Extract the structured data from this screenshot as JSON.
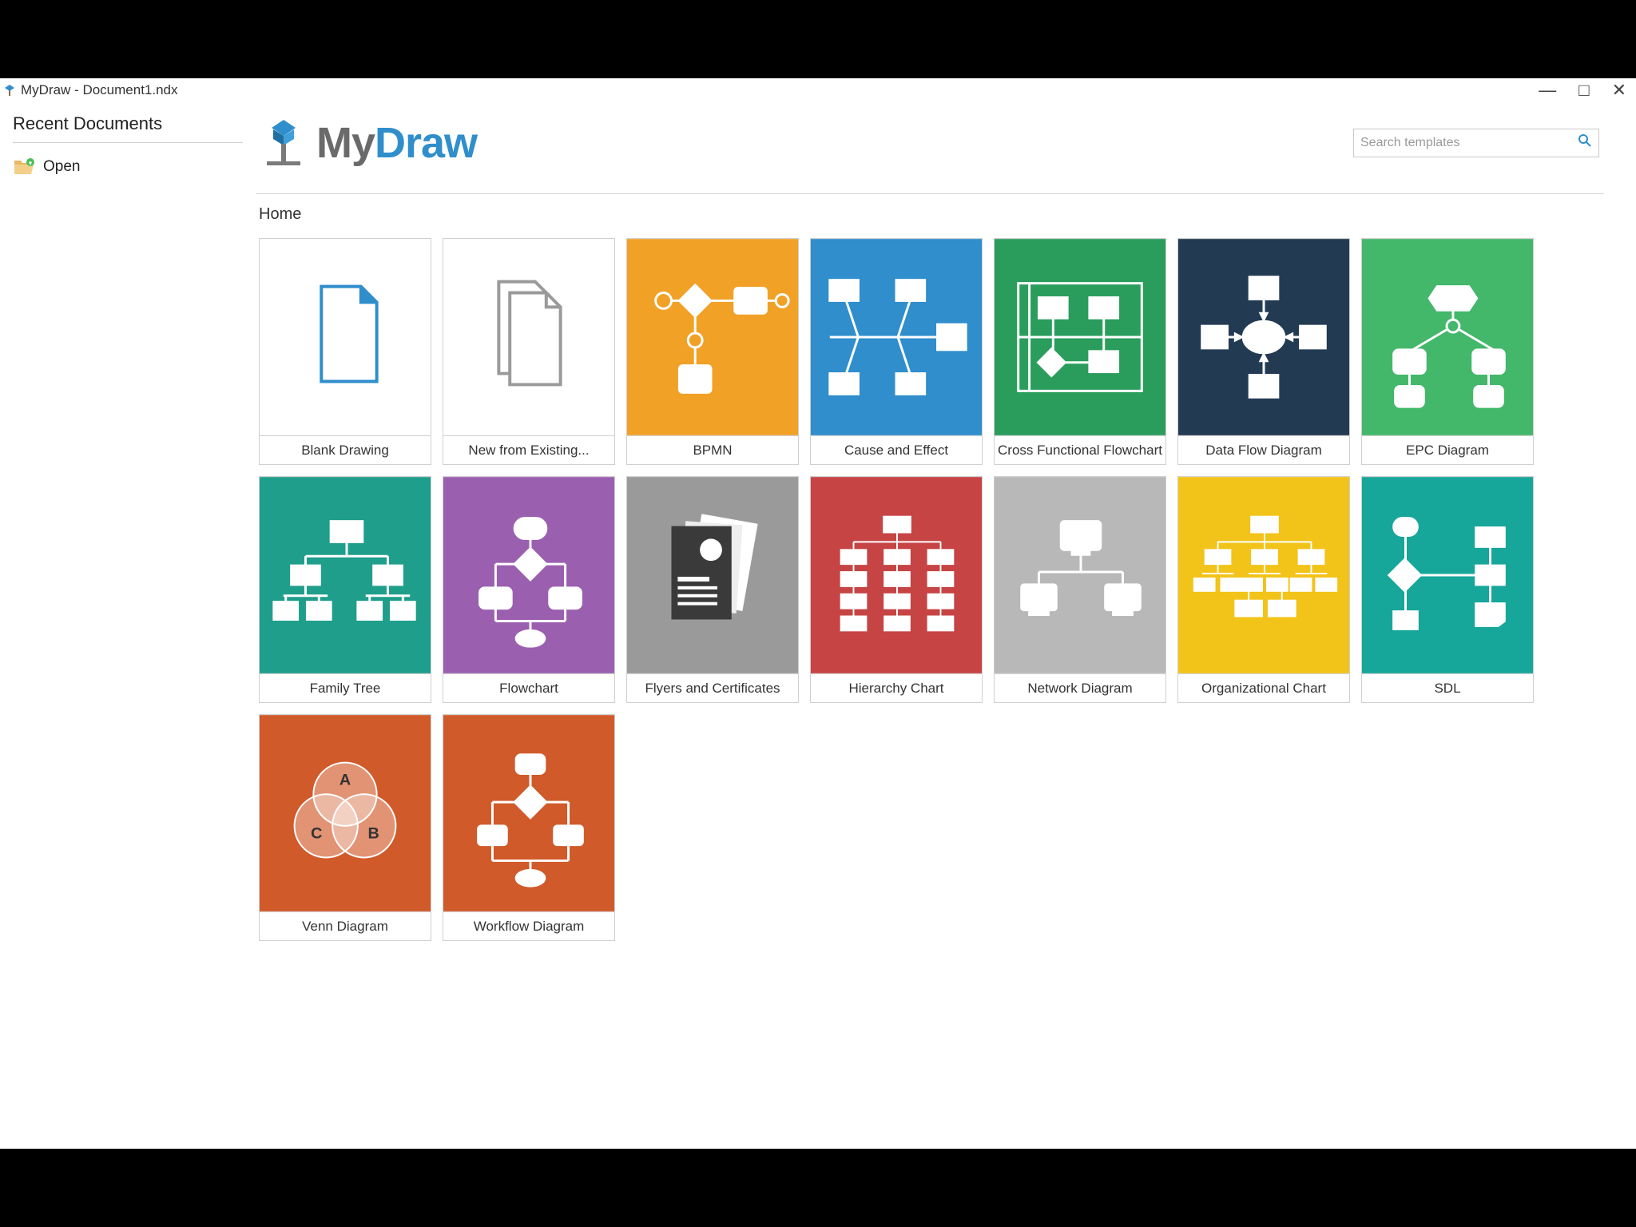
{
  "window": {
    "title": "MyDraw - Document1.ndx"
  },
  "sidebar": {
    "title": "Recent Documents",
    "open_label": "Open"
  },
  "logo": {
    "part1": "My",
    "part2": "Draw"
  },
  "search": {
    "placeholder": "Search templates"
  },
  "breadcrumb": "Home",
  "tiles": [
    {
      "label": "Blank Drawing"
    },
    {
      "label": "New from Existing..."
    },
    {
      "label": "BPMN"
    },
    {
      "label": "Cause and Effect"
    },
    {
      "label": "Cross Functional Flowchart"
    },
    {
      "label": "Data Flow Diagram"
    },
    {
      "label": "EPC Diagram"
    },
    {
      "label": "Family Tree"
    },
    {
      "label": "Flowchart"
    },
    {
      "label": "Flyers and Certificates"
    },
    {
      "label": "Hierarchy Chart"
    },
    {
      "label": "Network Diagram"
    },
    {
      "label": "Organizational Chart"
    },
    {
      "label": "SDL"
    },
    {
      "label": "Venn Diagram"
    },
    {
      "label": "Workflow Diagram"
    }
  ],
  "colors": {
    "orange": "#f0a126",
    "blue": "#2f8ecb",
    "green": "#2a9d5c",
    "navy": "#233a53",
    "green2": "#43b76a",
    "teal": "#1f9e8b",
    "purple": "#9b5fb0",
    "gray": "#9a9a9a",
    "red": "#c64444",
    "lgray": "#b8b8b8",
    "yellow": "#f2c318",
    "teal2": "#17a69a",
    "dorange": "#d15a2a"
  }
}
